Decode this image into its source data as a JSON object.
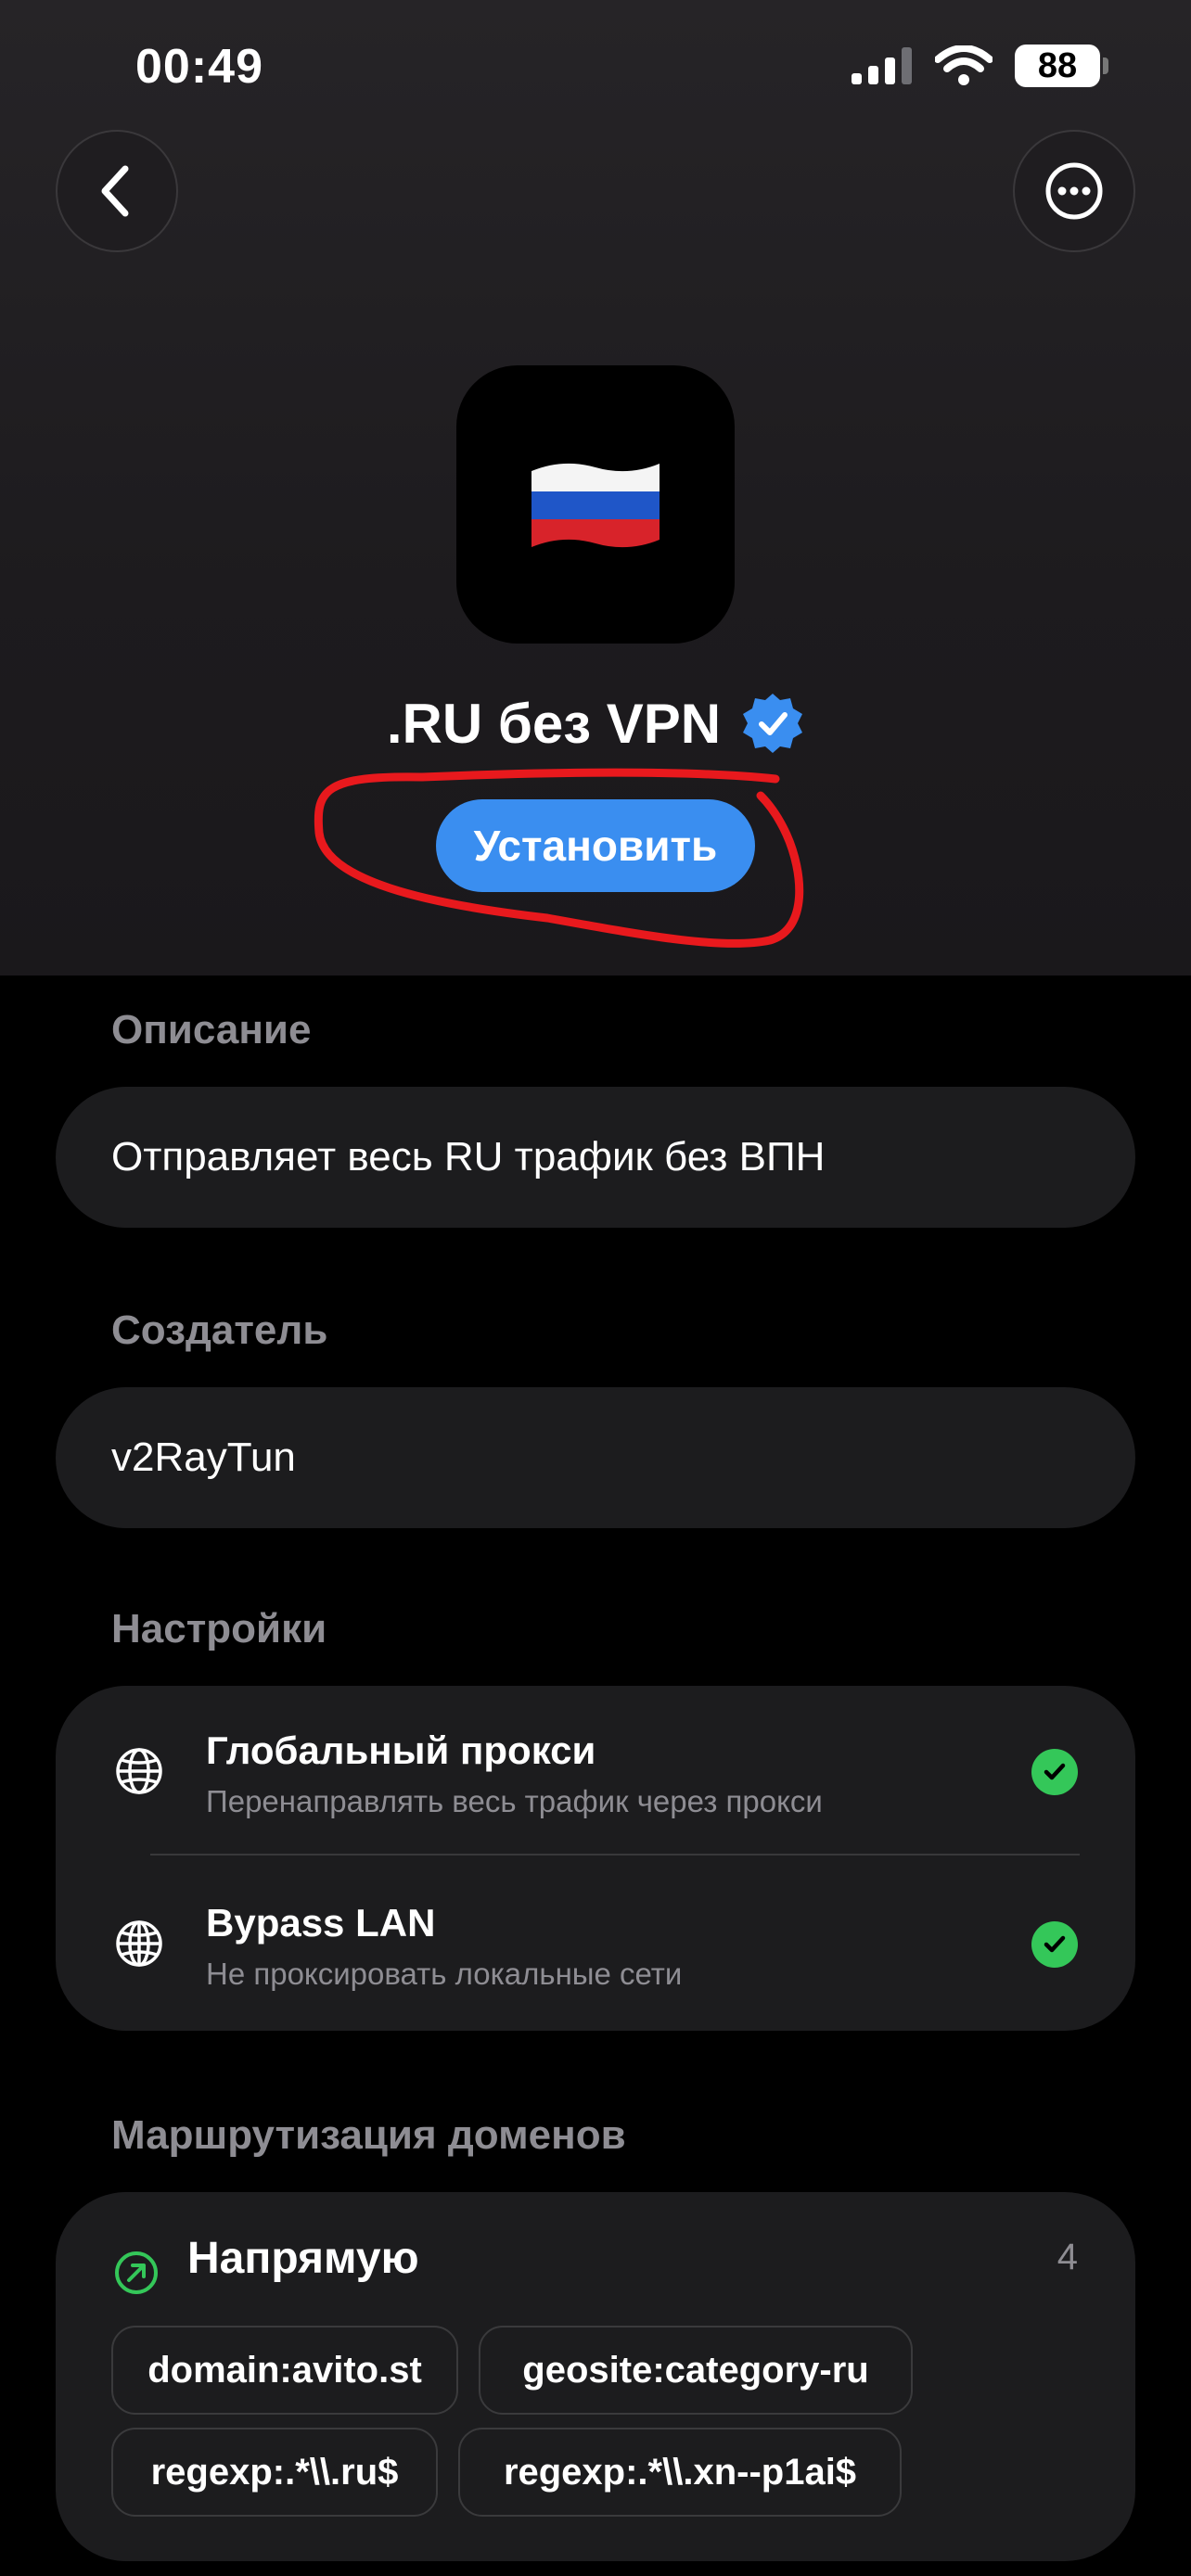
{
  "status_bar": {
    "time": "00:49",
    "battery": "88"
  },
  "app": {
    "flag": "🇷🇺",
    "title": ".RU без VPN",
    "install_label": "Установить"
  },
  "description": {
    "label": "Описание",
    "text": "Отправляет весь RU трафик без ВПН"
  },
  "creator": {
    "label": "Создатель",
    "text": "v2RayTun"
  },
  "settings": {
    "label": "Настройки",
    "items": [
      {
        "title": "Глобальный прокси",
        "subtitle": "Перенаправлять весь трафик через прокси",
        "icon": "globe-icon",
        "enabled": true
      },
      {
        "title": "Bypass LAN",
        "subtitle": "Не проксировать локальные сети",
        "icon": "globe-grid-icon",
        "enabled": true
      }
    ]
  },
  "routing": {
    "label": "Маршрутизация доменов",
    "group": {
      "title": "Напрямую",
      "count": "4",
      "icon": "direct-arrow-icon",
      "rules": [
        "domain:avito.st",
        "geosite:category-ru",
        "regexp:.*\\\\.ru$",
        "regexp:.*\\\\.xn--p1ai$"
      ]
    }
  },
  "colors": {
    "accent": "#3a8ef0",
    "success": "#34c759",
    "annotation": "#e8191d",
    "card": "#1c1c1e"
  }
}
